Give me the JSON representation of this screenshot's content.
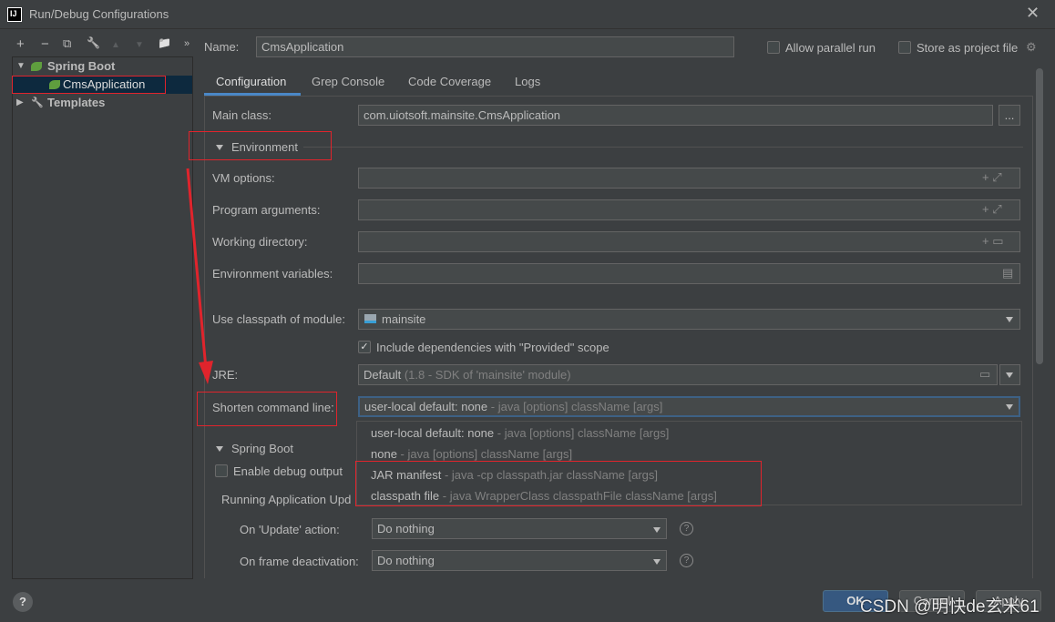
{
  "window": {
    "title": "Run/Debug Configurations",
    "close": "✕"
  },
  "toolbar": {
    "add": "+",
    "remove": "−",
    "copy": "⧉",
    "edit": "🔧",
    "up": "▲",
    "down": "▼",
    "folder": "📁",
    "more": "»"
  },
  "tree": {
    "groups": [
      {
        "label": "Spring Boot",
        "expanded": true,
        "children": [
          {
            "label": "CmsApplication",
            "selected": true
          }
        ]
      },
      {
        "label": "Templates",
        "expanded": false
      }
    ]
  },
  "header": {
    "name_label": "Name:",
    "name_value": "CmsApplication",
    "allow_parallel": "Allow parallel run",
    "store_project": "Store as project file"
  },
  "tabs": [
    {
      "label": "Configuration",
      "active": true
    },
    {
      "label": "Grep Console"
    },
    {
      "label": "Code Coverage"
    },
    {
      "label": "Logs"
    }
  ],
  "form": {
    "main_class_label": "Main class:",
    "main_class": "com.uiotsoft.mainsite.CmsApplication",
    "browse": "...",
    "environment": "Environment",
    "vm_options": "VM options:",
    "program_args": "Program arguments:",
    "working_dir": "Working directory:",
    "env_vars": "Environment variables:",
    "classpath_label": "Use classpath of module:",
    "classpath_value": "mainsite",
    "include_deps": "Include dependencies with \"Provided\" scope",
    "include_deps_checked": true,
    "jre_label": "JRE:",
    "jre_value": "Default",
    "jre_hint": "(1.8 - SDK of 'mainsite' module)",
    "shorten_label": "Shorten command line:",
    "shorten_value": "user-local default: none",
    "shorten_hint": "- java [options] className [args]",
    "spring_boot": "Spring Boot",
    "debug_output": "Enable debug output",
    "running_updates": "Running Application Upd",
    "on_update_label": "On 'Update' action:",
    "on_update_value": "Do nothing",
    "on_frame_label": "On frame deactivation:",
    "on_frame_value": "Do nothing",
    "help": "?"
  },
  "dropdown": [
    {
      "name": "user-local default: none",
      "hint": "- java [options] className [args]"
    },
    {
      "name": "none",
      "hint": "- java [options] className [args]"
    },
    {
      "name": "JAR manifest",
      "hint": "- java -cp classpath.jar className [args]"
    },
    {
      "name": "classpath file",
      "hint": "- java WrapperClass classpathFile className [args]"
    }
  ],
  "footer": {
    "help": "?",
    "ok": "OK",
    "cancel": "Cancel",
    "apply": "Apply",
    "watermark": "CSDN @明快de玄米61"
  },
  "colors": {
    "bg": "#3c3f41",
    "selection": "#0d293e",
    "accent": "#4a88c7",
    "annotation": "#e0242c",
    "ok": "#365880"
  }
}
